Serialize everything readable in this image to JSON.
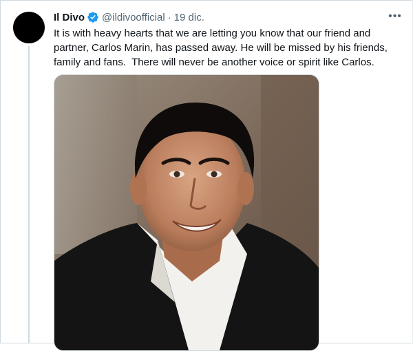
{
  "tweet": {
    "author_name": "Il Divo",
    "handle": "@ildivoofficial",
    "separator": "·",
    "date": "19 dic.",
    "more_label": "•••",
    "text": "It is with heavy hearts that we are letting you know that our friend and partner, Carlos Marin, has passed away. He will be missed by his friends, family and fans.  There will never be another voice or spirit like Carlos.",
    "verified_icon": "verified-badge-icon",
    "media_kind": "photo"
  },
  "colors": {
    "text_primary": "#0f1419",
    "text_secondary": "#536471",
    "verified_blue": "#1d9bf0",
    "border": "#cfd9de"
  }
}
